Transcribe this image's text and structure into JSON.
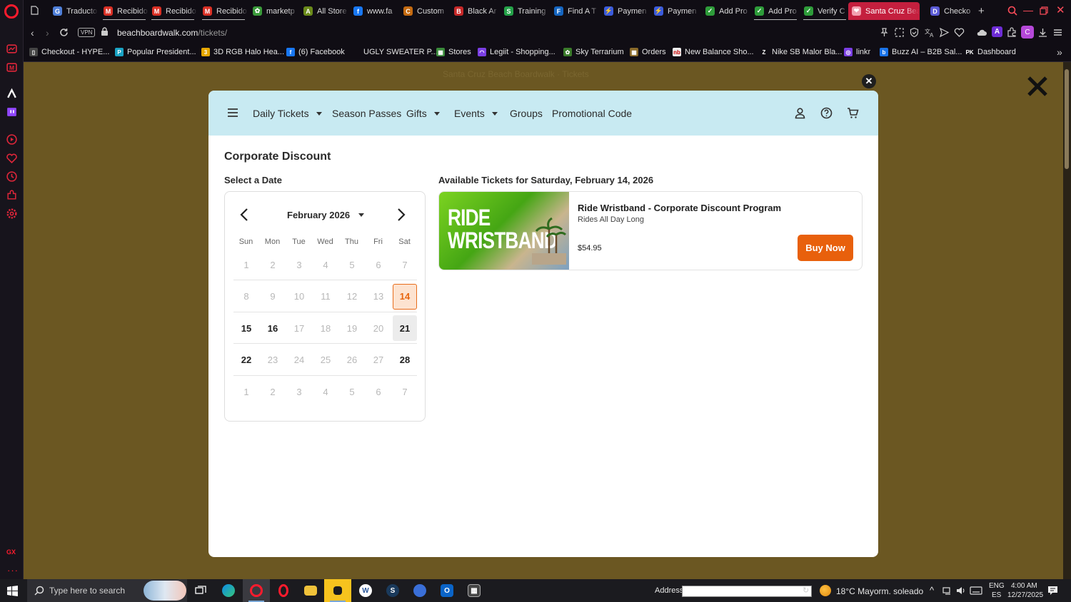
{
  "browser": {
    "tabs": [
      {
        "label": "Traducto",
        "color": "#4f7fd9",
        "glyph": "G"
      },
      {
        "label": "Recibido",
        "color": "#d93025",
        "glyph": "M"
      },
      {
        "label": "Recibido",
        "color": "#d93025",
        "glyph": "M"
      },
      {
        "label": "Recibido",
        "color": "#d93025",
        "glyph": "M"
      },
      {
        "label": "marketp",
        "color": "#3a9a3a",
        "glyph": "✿"
      },
      {
        "label": "All Store",
        "color": "#6a8a1a",
        "glyph": "A"
      },
      {
        "label": "www.fa",
        "color": "#1877f2",
        "glyph": "f"
      },
      {
        "label": "Custom",
        "color": "#c46a10",
        "glyph": "C"
      },
      {
        "label": "Black Ar",
        "color": "#c62828",
        "glyph": "B"
      },
      {
        "label": "Training",
        "color": "#24a148",
        "glyph": "S"
      },
      {
        "label": "Find A T",
        "color": "#1565c0",
        "glyph": "F"
      },
      {
        "label": "Paymen",
        "color": "#3b5bdb",
        "glyph": "⚡"
      },
      {
        "label": "Paymen",
        "color": "#3b5bdb",
        "glyph": "⚡"
      },
      {
        "label": "Add Pro",
        "color": "#2e9c3a",
        "glyph": "✓"
      },
      {
        "label": "Add Pro",
        "color": "#2e9c3a",
        "glyph": "✓"
      },
      {
        "label": "Verify C",
        "color": "#2e9c3a",
        "glyph": "✓"
      },
      {
        "label": "Santa Cruz Bea",
        "color": "#f2a0b0",
        "glyph": "❤",
        "active": true
      },
      {
        "label": "Checko",
        "color": "#5b5bd6",
        "glyph": "D"
      }
    ],
    "new_tab_label": "+",
    "address": {
      "vpn_label": "VPN",
      "domain": "beachboardwalk.com",
      "path": "/tickets/"
    },
    "bookmarks": [
      {
        "label": "Checkout - HYPE...",
        "color": "#444",
        "glyph": "▯"
      },
      {
        "label": "Popular President...",
        "color": "#1aa3c4",
        "glyph": "P"
      },
      {
        "label": "3D RGB Halo Hea...",
        "color": "#e6a700",
        "glyph": "3"
      },
      {
        "label": "(6) Facebook",
        "color": "#1877f2",
        "glyph": "f"
      },
      {
        "label": "UGLY SWEATER P...",
        "color": "#100d14",
        "glyph": ""
      },
      {
        "label": "Stores",
        "color": "#3a8a3a",
        "glyph": "▦"
      },
      {
        "label": "Legiit - Shopping...",
        "color": "#7b3fe4",
        "glyph": "◠"
      },
      {
        "label": "Sky Terrarium",
        "color": "#3a7a2a",
        "glyph": "✿"
      },
      {
        "label": "Orders",
        "color": "#8a6a2a",
        "glyph": "▦"
      },
      {
        "label": "New Balance Sho...",
        "color": "#eee",
        "glyph": "nb"
      },
      {
        "label": "Nike SB Malor Bla...",
        "color": "#100d14",
        "glyph": "Z"
      },
      {
        "label": "linkr",
        "color": "#7b3fe4",
        "glyph": "◎"
      },
      {
        "label": "Buzz AI – B2B Sal...",
        "color": "#1a73e8",
        "glyph": "b"
      },
      {
        "label": "Dashboard",
        "color": "#100d14",
        "glyph": "PK"
      }
    ]
  },
  "page": {
    "ghost_header": "Santa Cruz Beach Boardwalk · Tickets",
    "nav": {
      "items": [
        {
          "label": "Daily Tickets",
          "dropdown": true
        },
        {
          "label": "Season Passes",
          "dropdown": false
        },
        {
          "label": "Gifts",
          "dropdown": true
        },
        {
          "label": "Events",
          "dropdown": true
        },
        {
          "label": "Groups",
          "dropdown": false
        },
        {
          "label": "Promotional Code",
          "dropdown": false
        }
      ]
    },
    "title": "Corporate Discount",
    "select_date_label": "Select a Date",
    "available_label": "Available Tickets for Saturday, February 14, 2026",
    "calendar": {
      "month_label": "February 2026",
      "weekdays": [
        "Sun",
        "Mon",
        "Tue",
        "Wed",
        "Thu",
        "Fri",
        "Sat"
      ],
      "weeks": [
        [
          {
            "d": "1",
            "s": "dis"
          },
          {
            "d": "2",
            "s": "dis"
          },
          {
            "d": "3",
            "s": "dis"
          },
          {
            "d": "4",
            "s": "dis"
          },
          {
            "d": "5",
            "s": "dis"
          },
          {
            "d": "6",
            "s": "dis"
          },
          {
            "d": "7",
            "s": "dis"
          }
        ],
        [
          {
            "d": "8",
            "s": "dis"
          },
          {
            "d": "9",
            "s": "dis"
          },
          {
            "d": "10",
            "s": "dis"
          },
          {
            "d": "11",
            "s": "dis"
          },
          {
            "d": "12",
            "s": "dis"
          },
          {
            "d": "13",
            "s": "dis"
          },
          {
            "d": "14",
            "s": "sel"
          }
        ],
        [
          {
            "d": "15",
            "s": "avail"
          },
          {
            "d": "16",
            "s": "avail"
          },
          {
            "d": "17",
            "s": "dis"
          },
          {
            "d": "18",
            "s": "dis"
          },
          {
            "d": "19",
            "s": "dis"
          },
          {
            "d": "20",
            "s": "dis"
          },
          {
            "d": "21",
            "s": "wk"
          }
        ],
        [
          {
            "d": "22",
            "s": "avail"
          },
          {
            "d": "23",
            "s": "dis"
          },
          {
            "d": "24",
            "s": "dis"
          },
          {
            "d": "25",
            "s": "dis"
          },
          {
            "d": "26",
            "s": "dis"
          },
          {
            "d": "27",
            "s": "dis"
          },
          {
            "d": "28",
            "s": "avail"
          }
        ],
        [
          {
            "d": "1",
            "s": "dis"
          },
          {
            "d": "2",
            "s": "dis"
          },
          {
            "d": "3",
            "s": "dis"
          },
          {
            "d": "4",
            "s": "dis"
          },
          {
            "d": "5",
            "s": "dis"
          },
          {
            "d": "6",
            "s": "dis"
          },
          {
            "d": "7",
            "s": "dis"
          }
        ]
      ]
    },
    "ticket": {
      "image_line1": "RIDE",
      "image_line2": "WRISTBAND",
      "name": "Ride Wristband - Corporate Discount Program",
      "subtitle": "Rides All Day Long",
      "price": "$54.95",
      "buy_label": "Buy Now"
    },
    "colors": {
      "accent": "#e8600c",
      "nav_bg": "#c8eaf2",
      "overlay": "#6b5722"
    }
  },
  "taskbar": {
    "search_placeholder": "Type here to search",
    "address_label": "Address",
    "weather": "18°C  Mayorm. soleado",
    "lang_line1": "ENG",
    "lang_line2": "ES",
    "time": "4:00 AM",
    "date": "12/27/2025"
  }
}
